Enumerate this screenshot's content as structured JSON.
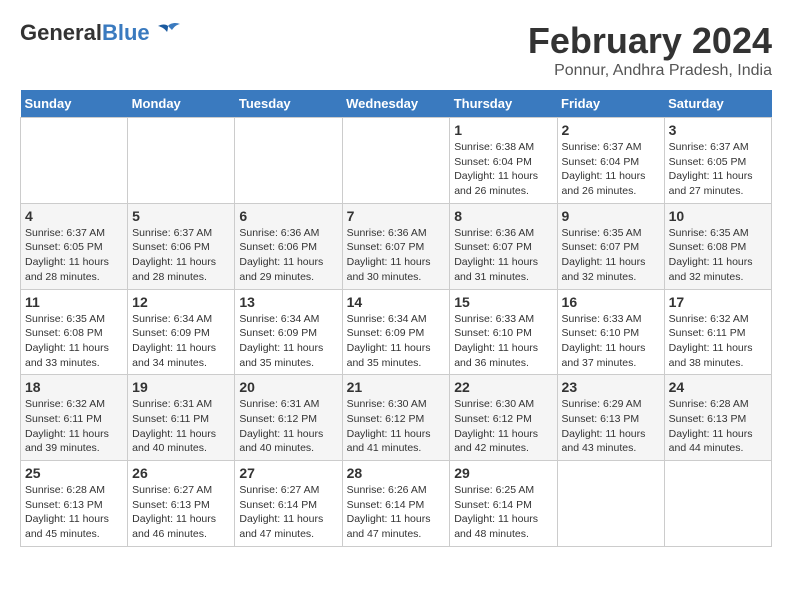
{
  "header": {
    "logo_general": "General",
    "logo_blue": "Blue",
    "month": "February 2024",
    "location": "Ponnur, Andhra Pradesh, India"
  },
  "days_of_week": [
    "Sunday",
    "Monday",
    "Tuesday",
    "Wednesday",
    "Thursday",
    "Friday",
    "Saturday"
  ],
  "weeks": [
    [
      {
        "day": "",
        "info": ""
      },
      {
        "day": "",
        "info": ""
      },
      {
        "day": "",
        "info": ""
      },
      {
        "day": "",
        "info": ""
      },
      {
        "day": "1",
        "info": "Sunrise: 6:38 AM\nSunset: 6:04 PM\nDaylight: 11 hours and 26 minutes."
      },
      {
        "day": "2",
        "info": "Sunrise: 6:37 AM\nSunset: 6:04 PM\nDaylight: 11 hours and 26 minutes."
      },
      {
        "day": "3",
        "info": "Sunrise: 6:37 AM\nSunset: 6:05 PM\nDaylight: 11 hours and 27 minutes."
      }
    ],
    [
      {
        "day": "4",
        "info": "Sunrise: 6:37 AM\nSunset: 6:05 PM\nDaylight: 11 hours and 28 minutes."
      },
      {
        "day": "5",
        "info": "Sunrise: 6:37 AM\nSunset: 6:06 PM\nDaylight: 11 hours and 28 minutes."
      },
      {
        "day": "6",
        "info": "Sunrise: 6:36 AM\nSunset: 6:06 PM\nDaylight: 11 hours and 29 minutes."
      },
      {
        "day": "7",
        "info": "Sunrise: 6:36 AM\nSunset: 6:07 PM\nDaylight: 11 hours and 30 minutes."
      },
      {
        "day": "8",
        "info": "Sunrise: 6:36 AM\nSunset: 6:07 PM\nDaylight: 11 hours and 31 minutes."
      },
      {
        "day": "9",
        "info": "Sunrise: 6:35 AM\nSunset: 6:07 PM\nDaylight: 11 hours and 32 minutes."
      },
      {
        "day": "10",
        "info": "Sunrise: 6:35 AM\nSunset: 6:08 PM\nDaylight: 11 hours and 32 minutes."
      }
    ],
    [
      {
        "day": "11",
        "info": "Sunrise: 6:35 AM\nSunset: 6:08 PM\nDaylight: 11 hours and 33 minutes."
      },
      {
        "day": "12",
        "info": "Sunrise: 6:34 AM\nSunset: 6:09 PM\nDaylight: 11 hours and 34 minutes."
      },
      {
        "day": "13",
        "info": "Sunrise: 6:34 AM\nSunset: 6:09 PM\nDaylight: 11 hours and 35 minutes."
      },
      {
        "day": "14",
        "info": "Sunrise: 6:34 AM\nSunset: 6:09 PM\nDaylight: 11 hours and 35 minutes."
      },
      {
        "day": "15",
        "info": "Sunrise: 6:33 AM\nSunset: 6:10 PM\nDaylight: 11 hours and 36 minutes."
      },
      {
        "day": "16",
        "info": "Sunrise: 6:33 AM\nSunset: 6:10 PM\nDaylight: 11 hours and 37 minutes."
      },
      {
        "day": "17",
        "info": "Sunrise: 6:32 AM\nSunset: 6:11 PM\nDaylight: 11 hours and 38 minutes."
      }
    ],
    [
      {
        "day": "18",
        "info": "Sunrise: 6:32 AM\nSunset: 6:11 PM\nDaylight: 11 hours and 39 minutes."
      },
      {
        "day": "19",
        "info": "Sunrise: 6:31 AM\nSunset: 6:11 PM\nDaylight: 11 hours and 40 minutes."
      },
      {
        "day": "20",
        "info": "Sunrise: 6:31 AM\nSunset: 6:12 PM\nDaylight: 11 hours and 40 minutes."
      },
      {
        "day": "21",
        "info": "Sunrise: 6:30 AM\nSunset: 6:12 PM\nDaylight: 11 hours and 41 minutes."
      },
      {
        "day": "22",
        "info": "Sunrise: 6:30 AM\nSunset: 6:12 PM\nDaylight: 11 hours and 42 minutes."
      },
      {
        "day": "23",
        "info": "Sunrise: 6:29 AM\nSunset: 6:13 PM\nDaylight: 11 hours and 43 minutes."
      },
      {
        "day": "24",
        "info": "Sunrise: 6:28 AM\nSunset: 6:13 PM\nDaylight: 11 hours and 44 minutes."
      }
    ],
    [
      {
        "day": "25",
        "info": "Sunrise: 6:28 AM\nSunset: 6:13 PM\nDaylight: 11 hours and 45 minutes."
      },
      {
        "day": "26",
        "info": "Sunrise: 6:27 AM\nSunset: 6:13 PM\nDaylight: 11 hours and 46 minutes."
      },
      {
        "day": "27",
        "info": "Sunrise: 6:27 AM\nSunset: 6:14 PM\nDaylight: 11 hours and 47 minutes."
      },
      {
        "day": "28",
        "info": "Sunrise: 6:26 AM\nSunset: 6:14 PM\nDaylight: 11 hours and 47 minutes."
      },
      {
        "day": "29",
        "info": "Sunrise: 6:25 AM\nSunset: 6:14 PM\nDaylight: 11 hours and 48 minutes."
      },
      {
        "day": "",
        "info": ""
      },
      {
        "day": "",
        "info": ""
      }
    ]
  ]
}
